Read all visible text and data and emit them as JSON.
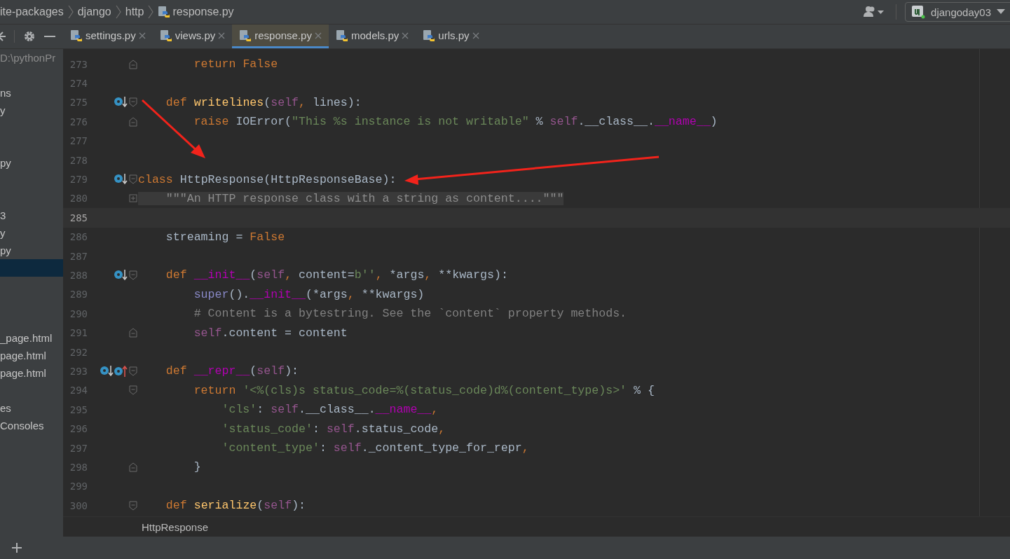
{
  "breadcrumb": [
    {
      "label": "ite-packages",
      "kind": "folder"
    },
    {
      "label": "django",
      "kind": "folder"
    },
    {
      "label": "http",
      "kind": "folder"
    },
    {
      "label": "response.py",
      "kind": "python-file"
    }
  ],
  "run_config": {
    "label": "djangoday03"
  },
  "tabs": [
    {
      "label": "settings.py",
      "selected": false
    },
    {
      "label": "views.py",
      "selected": false
    },
    {
      "label": "response.py",
      "selected": true
    },
    {
      "label": "models.py",
      "selected": false
    },
    {
      "label": "urls.py",
      "selected": false
    }
  ],
  "project_panel": {
    "items": [
      {
        "kind": "path",
        "label": "D:\\pythonPr",
        "selected": false
      },
      {
        "kind": "blank"
      },
      {
        "kind": "file",
        "label": "ns",
        "selected": false
      },
      {
        "kind": "file",
        "label": "y",
        "selected": false
      },
      {
        "kind": "blank"
      },
      {
        "kind": "blank"
      },
      {
        "kind": "file",
        "label": "py",
        "selected": false
      },
      {
        "kind": "blank"
      },
      {
        "kind": "blank"
      },
      {
        "kind": "file",
        "label": "3",
        "selected": false
      },
      {
        "kind": "file",
        "label": "y",
        "selected": false
      },
      {
        "kind": "file",
        "label": "py",
        "selected": false
      },
      {
        "kind": "blank",
        "selected": true
      },
      {
        "kind": "blank"
      },
      {
        "kind": "blank"
      },
      {
        "kind": "blank"
      },
      {
        "kind": "file",
        "label": "_page.html",
        "selected": false
      },
      {
        "kind": "file",
        "label": "page.html",
        "selected": false
      },
      {
        "kind": "file",
        "label": "page.html",
        "selected": false
      },
      {
        "kind": "blank"
      },
      {
        "kind": "file",
        "label": "es",
        "selected": false
      },
      {
        "kind": "file",
        "label": "Consoles",
        "selected": false
      }
    ]
  },
  "editor": {
    "lines": [
      {
        "number": "273",
        "current": false,
        "fold": {
          "kind": "end"
        },
        "code": [
          {
            "text": "        return",
            "kind": "kw"
          },
          {
            "text": " False",
            "kind": "kw"
          }
        ]
      },
      {
        "number": "274",
        "current": false
      },
      {
        "number": "275",
        "current": false,
        "fold": {
          "kind": "start"
        },
        "markers": [
          {
            "kind": "implemented"
          }
        ],
        "code": [
          {
            "text": "    def",
            "kind": "kw"
          },
          {
            "text": " writelines",
            "kind": "fn"
          },
          {
            "text": "(",
            "kind": "plain"
          },
          {
            "text": "self",
            "kind": "self"
          },
          {
            "text": ", ",
            "kind": "kw"
          },
          {
            "text": "lines):",
            "kind": "plain"
          }
        ]
      },
      {
        "number": "276",
        "current": false,
        "fold": {
          "kind": "end"
        },
        "code": [
          {
            "text": "        raise",
            "kind": "kw"
          },
          {
            "text": " IOError(",
            "kind": "plain"
          },
          {
            "text": "\"This %s instance is not writable\"",
            "kind": "str"
          },
          {
            "text": " % ",
            "kind": "plain"
          },
          {
            "text": "self",
            "kind": "self"
          },
          {
            "text": ".__class__.",
            "kind": "plain"
          },
          {
            "text": "__name__",
            "kind": "dunder"
          },
          {
            "text": ")",
            "kind": "plain"
          }
        ]
      },
      {
        "number": "277",
        "current": false
      },
      {
        "number": "278",
        "current": false
      },
      {
        "number": "279",
        "current": false,
        "fold": {
          "kind": "start"
        },
        "markers": [
          {
            "kind": "implemented"
          }
        ],
        "code": [
          {
            "text": "class",
            "kind": "kw"
          },
          {
            "text": " HttpResponse(HttpResponseBase):",
            "kind": "plain"
          }
        ]
      },
      {
        "number": "280",
        "current": false,
        "fold": {
          "kind": "collapsed"
        },
        "code": [
          {
            "text": "    \"\"\"An HTTP response class with a string as content....\"\"\"",
            "kind": "doc"
          }
        ]
      },
      {
        "number": "285",
        "current": true
      },
      {
        "number": "286",
        "current": false,
        "code": [
          {
            "text": "    streaming = ",
            "kind": "plain"
          },
          {
            "text": "False",
            "kind": "kw"
          }
        ]
      },
      {
        "number": "287",
        "current": false
      },
      {
        "number": "288",
        "current": false,
        "fold": {
          "kind": "start"
        },
        "markers": [
          {
            "kind": "implemented"
          }
        ],
        "code": [
          {
            "text": "    def",
            "kind": "kw"
          },
          {
            "text": " __init__",
            "kind": "dunder"
          },
          {
            "text": "(",
            "kind": "plain"
          },
          {
            "text": "self",
            "kind": "self"
          },
          {
            "text": ", ",
            "kind": "kw"
          },
          {
            "text": "content=",
            "kind": "plain"
          },
          {
            "text": "b''",
            "kind": "str"
          },
          {
            "text": ", ",
            "kind": "kw"
          },
          {
            "text": "*args",
            "kind": "plain"
          },
          {
            "text": ", ",
            "kind": "kw"
          },
          {
            "text": "**kwargs):",
            "kind": "plain"
          }
        ]
      },
      {
        "number": "289",
        "current": false,
        "code": [
          {
            "text": "        super",
            "kind": "builtin"
          },
          {
            "text": "().",
            "kind": "plain"
          },
          {
            "text": "__init__",
            "kind": "dunder"
          },
          {
            "text": "(*args",
            "kind": "plain"
          },
          {
            "text": ", ",
            "kind": "kw"
          },
          {
            "text": "**kwargs)",
            "kind": "plain"
          }
        ]
      },
      {
        "number": "290",
        "current": false,
        "code": [
          {
            "text": "        # Content is a bytestring. See the `content` property methods.",
            "kind": "comment"
          }
        ]
      },
      {
        "number": "291",
        "current": false,
        "fold": {
          "kind": "end"
        },
        "code": [
          {
            "text": "        self",
            "kind": "self"
          },
          {
            "text": ".content = content",
            "kind": "plain"
          }
        ]
      },
      {
        "number": "292",
        "current": false
      },
      {
        "number": "293",
        "current": false,
        "fold": {
          "kind": "start"
        },
        "markers": [
          {
            "kind": "implemented"
          },
          {
            "kind": "overrides"
          }
        ],
        "code": [
          {
            "text": "    def",
            "kind": "kw"
          },
          {
            "text": " __repr__",
            "kind": "dunder"
          },
          {
            "text": "(",
            "kind": "plain"
          },
          {
            "text": "self",
            "kind": "self"
          },
          {
            "text": "):",
            "kind": "plain"
          }
        ]
      },
      {
        "number": "294",
        "current": false,
        "fold": {
          "kind": "start"
        },
        "code": [
          {
            "text": "        return",
            "kind": "kw"
          },
          {
            "text": " '<%(cls)s status_code=%(status_code)d%(content_type)s>'",
            "kind": "str"
          },
          {
            "text": " % {",
            "kind": "plain"
          }
        ]
      },
      {
        "number": "295",
        "current": false,
        "code": [
          {
            "text": "            'cls'",
            "kind": "str"
          },
          {
            "text": ": ",
            "kind": "plain"
          },
          {
            "text": "self",
            "kind": "self"
          },
          {
            "text": ".__class__.",
            "kind": "plain"
          },
          {
            "text": "__name__",
            "kind": "dunder"
          },
          {
            "text": ",",
            "kind": "kw"
          }
        ]
      },
      {
        "number": "296",
        "current": false,
        "code": [
          {
            "text": "            'status_code'",
            "kind": "str"
          },
          {
            "text": ": ",
            "kind": "plain"
          },
          {
            "text": "self",
            "kind": "self"
          },
          {
            "text": ".status_code",
            "kind": "plain"
          },
          {
            "text": ",",
            "kind": "kw"
          }
        ]
      },
      {
        "number": "297",
        "current": false,
        "code": [
          {
            "text": "            'content_type'",
            "kind": "str"
          },
          {
            "text": ": ",
            "kind": "plain"
          },
          {
            "text": "self",
            "kind": "self"
          },
          {
            "text": "._content_type_for_repr",
            "kind": "plain"
          },
          {
            "text": ",",
            "kind": "kw"
          }
        ]
      },
      {
        "number": "298",
        "current": false,
        "fold": {
          "kind": "end"
        },
        "code": [
          {
            "text": "        }",
            "kind": "plain"
          }
        ]
      },
      {
        "number": "299",
        "current": false
      },
      {
        "number": "300",
        "current": false,
        "fold": {
          "kind": "start"
        },
        "code": [
          {
            "text": "    def",
            "kind": "kw"
          },
          {
            "text": " serialize",
            "kind": "fn"
          },
          {
            "text": "(",
            "kind": "plain"
          },
          {
            "text": "self",
            "kind": "self"
          },
          {
            "text": "):",
            "kind": "plain"
          }
        ]
      }
    ]
  },
  "code_breadcrumb": {
    "label": "HttpResponse"
  }
}
